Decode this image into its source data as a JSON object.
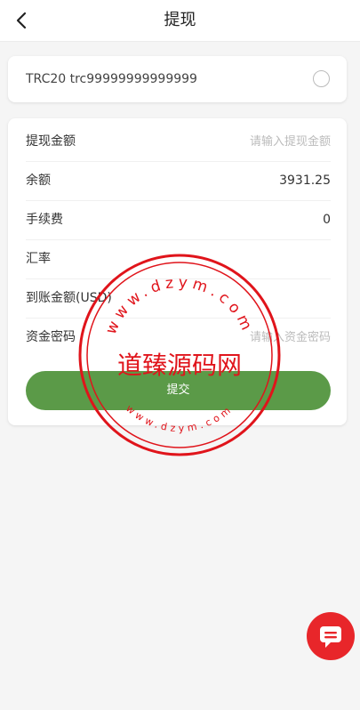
{
  "header": {
    "title": "提现"
  },
  "address": {
    "label": "TRC20 trc99999999999999"
  },
  "form": {
    "amount": {
      "label": "提现金额",
      "placeholder": "请输入提现金额"
    },
    "balance": {
      "label": "余额",
      "value": "3931.25"
    },
    "fee": {
      "label": "手续费",
      "value": "0"
    },
    "rate": {
      "label": "汇率",
      "value": ""
    },
    "received": {
      "label": "到账金额(USD)",
      "value": ""
    },
    "password": {
      "label": "资金密码",
      "placeholder": "请输入资金密码"
    },
    "submit_label": "提交"
  },
  "watermark": {
    "main_text": "道臻源码网",
    "top_text": "www.dzym.com",
    "bottom_text": "www.dzym.com",
    "color": "#e0141b"
  },
  "colors": {
    "accent": "#5b9a48",
    "chat": "#e8262a"
  },
  "icons": {
    "back": "back-icon",
    "chat": "chat-icon"
  }
}
